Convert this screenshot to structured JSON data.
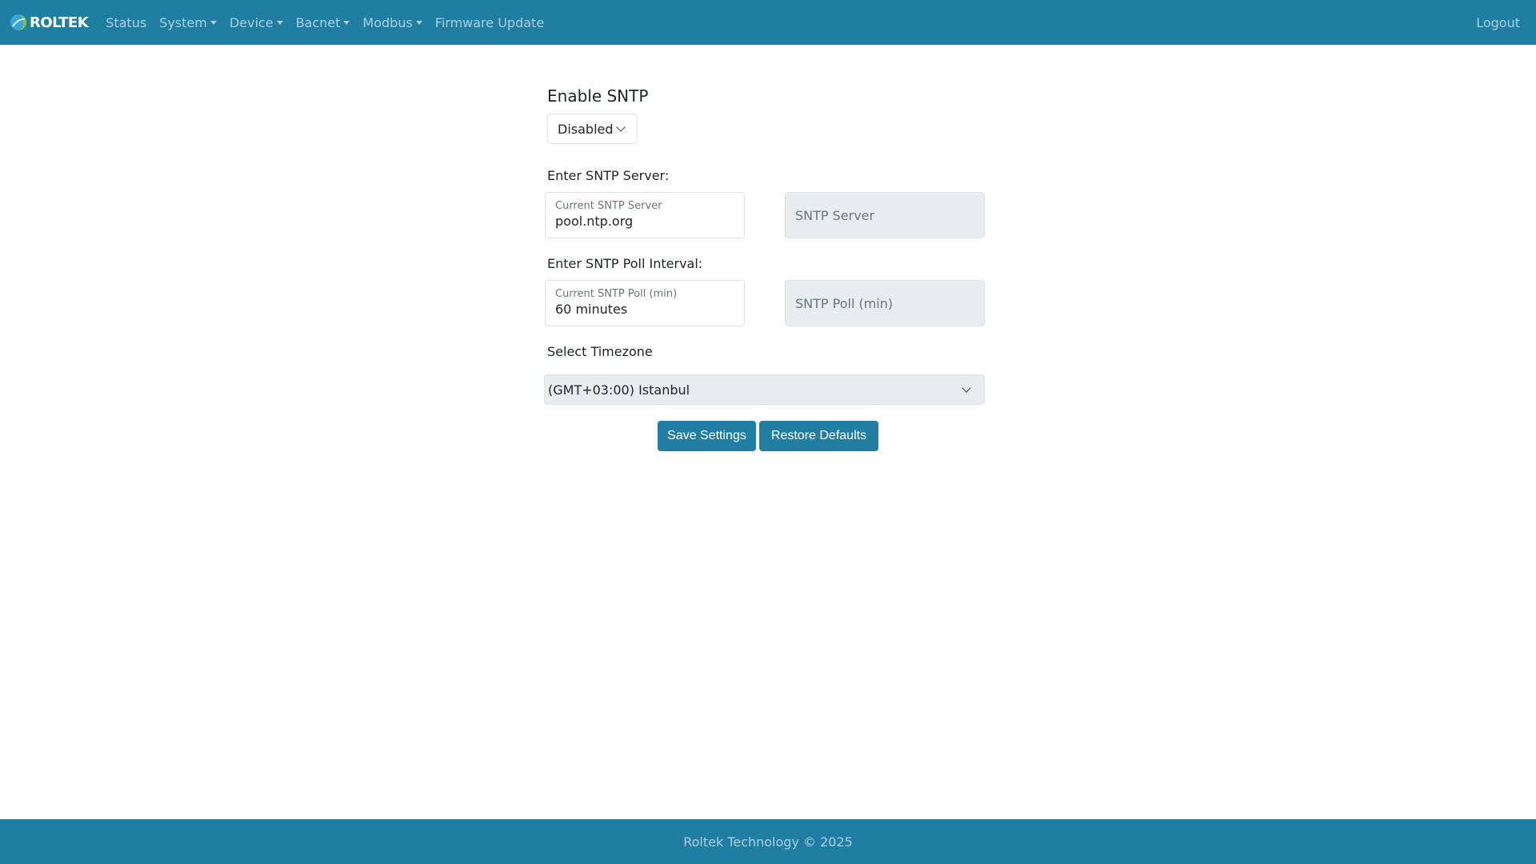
{
  "brand": {
    "name": "ROLTEK",
    "logo_icon": "roltek-logo-icon"
  },
  "nav": {
    "items": [
      {
        "label": "Status",
        "dropdown": false
      },
      {
        "label": "System",
        "dropdown": true
      },
      {
        "label": "Device",
        "dropdown": true
      },
      {
        "label": "Bacnet",
        "dropdown": true
      },
      {
        "label": "Modbus",
        "dropdown": true
      },
      {
        "label": "Firmware Update",
        "dropdown": false
      }
    ],
    "logout": "Logout"
  },
  "form": {
    "enable_heading": "Enable SNTP",
    "enable_value": "Disabled",
    "server_label": "Enter SNTP Server:",
    "server_current_label": "Current SNTP Server",
    "server_current_value": "pool.ntp.org",
    "server_placeholder": "SNTP Server",
    "poll_label": "Enter SNTP Poll Interval:",
    "poll_current_label": "Current SNTP Poll (min)",
    "poll_current_value": "60 minutes",
    "poll_placeholder": "SNTP Poll (min)",
    "timezone_label": "Select Timezone",
    "timezone_value": "(GMT+03:00) Istanbul"
  },
  "buttons": {
    "save": "Save Settings",
    "restore": "Restore Defaults"
  },
  "footer": {
    "text": "Roltek Technology © 2025"
  },
  "colors": {
    "primary": "#217ea3",
    "disabled_bg": "#e9ecef",
    "border": "#dee2e6"
  }
}
